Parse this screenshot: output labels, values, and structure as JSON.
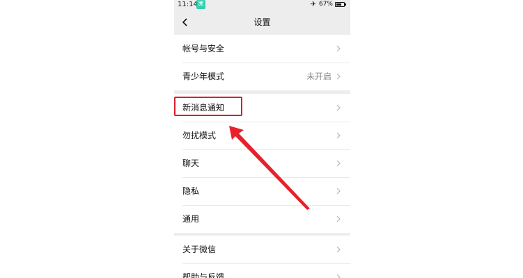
{
  "status_bar": {
    "time": "11:14",
    "app_icon_glyph": "⌘",
    "airplane_icon": "airplane-icon",
    "battery_percent": "67%",
    "battery_level": 0.67
  },
  "nav": {
    "back_icon": "chevron-left-icon",
    "title": "设置"
  },
  "groups": [
    {
      "items": [
        {
          "label": "帐号与安全",
          "value": ""
        },
        {
          "label": "青少年模式",
          "value": "未开启"
        }
      ]
    },
    {
      "items": [
        {
          "label": "新消息通知",
          "value": ""
        },
        {
          "label": "勿扰模式",
          "value": ""
        },
        {
          "label": "聊天",
          "value": ""
        },
        {
          "label": "隐私",
          "value": ""
        },
        {
          "label": "通用",
          "value": ""
        }
      ]
    },
    {
      "items": [
        {
          "label": "关于微信",
          "value": ""
        },
        {
          "label": "帮助与反馈",
          "value": ""
        }
      ]
    }
  ],
  "colors": {
    "annotation_red": "#d9202a",
    "page_background": "#ededed",
    "app_icon": "#2ed1b0"
  }
}
